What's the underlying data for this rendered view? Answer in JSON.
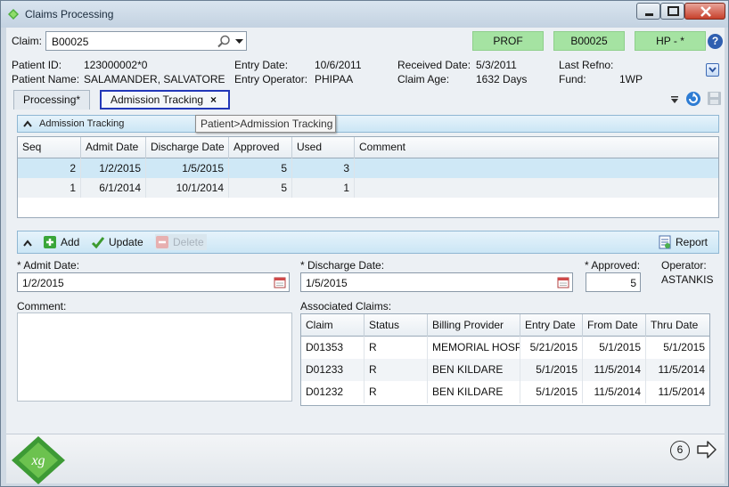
{
  "window": {
    "title": "Claims Processing"
  },
  "claim": {
    "label": "Claim:",
    "value": "B00025"
  },
  "pills": {
    "type": "PROF",
    "claim_no": "B00025",
    "plan": "HP - *"
  },
  "patient": {
    "id_label": "Patient ID:",
    "id_value": "123000002*0",
    "name_label": "Patient Name:",
    "name_value": "SALAMANDER, SALVATORE",
    "entry_date_label": "Entry Date:",
    "entry_date_value": "10/6/2011",
    "entry_operator_label": "Entry Operator:",
    "entry_operator_value": "PHIPAA",
    "received_date_label": "Received Date:",
    "received_date_value": "5/3/2011",
    "claim_age_label": "Claim Age:",
    "claim_age_value": "1632 Days",
    "last_refno_label": "Last Refno:",
    "last_refno_value": "",
    "fund_label": "Fund:",
    "fund_value": "1WP"
  },
  "tabs": {
    "processing": "Processing*",
    "admission": "Admission Tracking",
    "close_glyph": "×"
  },
  "tooltip": "Patient>Admission Tracking",
  "section_title": "Admission Tracking",
  "admissions": {
    "columns": [
      "Seq",
      "Admit Date",
      "Discharge Date",
      "Approved",
      "Used",
      "Comment"
    ],
    "rows": [
      {
        "seq": "2",
        "admit": "1/2/2015",
        "discharge": "1/5/2015",
        "approved": "5",
        "used": "3",
        "comment": ""
      },
      {
        "seq": "1",
        "admit": "6/1/2014",
        "discharge": "10/1/2014",
        "approved": "5",
        "used": "1",
        "comment": ""
      }
    ]
  },
  "toolbar": {
    "add": "Add",
    "update": "Update",
    "delete": "Delete",
    "report": "Report"
  },
  "form": {
    "admit_label": "* Admit Date:",
    "admit_value": "1/2/2015",
    "discharge_label": "* Discharge Date:",
    "discharge_value": "1/5/2015",
    "approved_label": "* Approved:",
    "approved_value": "5",
    "operator_label": "Operator:",
    "operator_value": "ASTANKIS",
    "comment_label": "Comment:",
    "assoc_label": "Associated Claims:"
  },
  "assoc": {
    "columns": [
      "Claim",
      "Status",
      "Billing Provider",
      "Entry Date",
      "From Date",
      "Thru Date"
    ],
    "rows": [
      {
        "claim": "D01353",
        "status": "R",
        "provider": "MEMORIAL HOSPI",
        "entry": "5/21/2015",
        "from": "5/1/2015",
        "thru": "5/1/2015"
      },
      {
        "claim": "D01233",
        "status": "R",
        "provider": "BEN KILDARE",
        "entry": "5/1/2015",
        "from": "11/5/2014",
        "thru": "11/5/2014"
      },
      {
        "claim": "D01232",
        "status": "R",
        "provider": "BEN KILDARE",
        "entry": "5/1/2015",
        "from": "11/5/2014",
        "thru": "11/5/2014"
      }
    ]
  },
  "footer": {
    "logo_text": "xg",
    "page_number": "6"
  },
  "colors": {
    "accent": "#2237b8",
    "pill_green": "#a5e3a2",
    "selected_row": "#cfe8f6"
  },
  "icons": [
    "app-diamond-icon",
    "search-icon",
    "dropdown-icon",
    "help-icon",
    "expand-icon",
    "collapse-icon",
    "calendar-icon",
    "add-icon",
    "update-icon",
    "delete-icon",
    "report-icon",
    "refresh-icon",
    "save-icon",
    "next-arrow-icon"
  ]
}
